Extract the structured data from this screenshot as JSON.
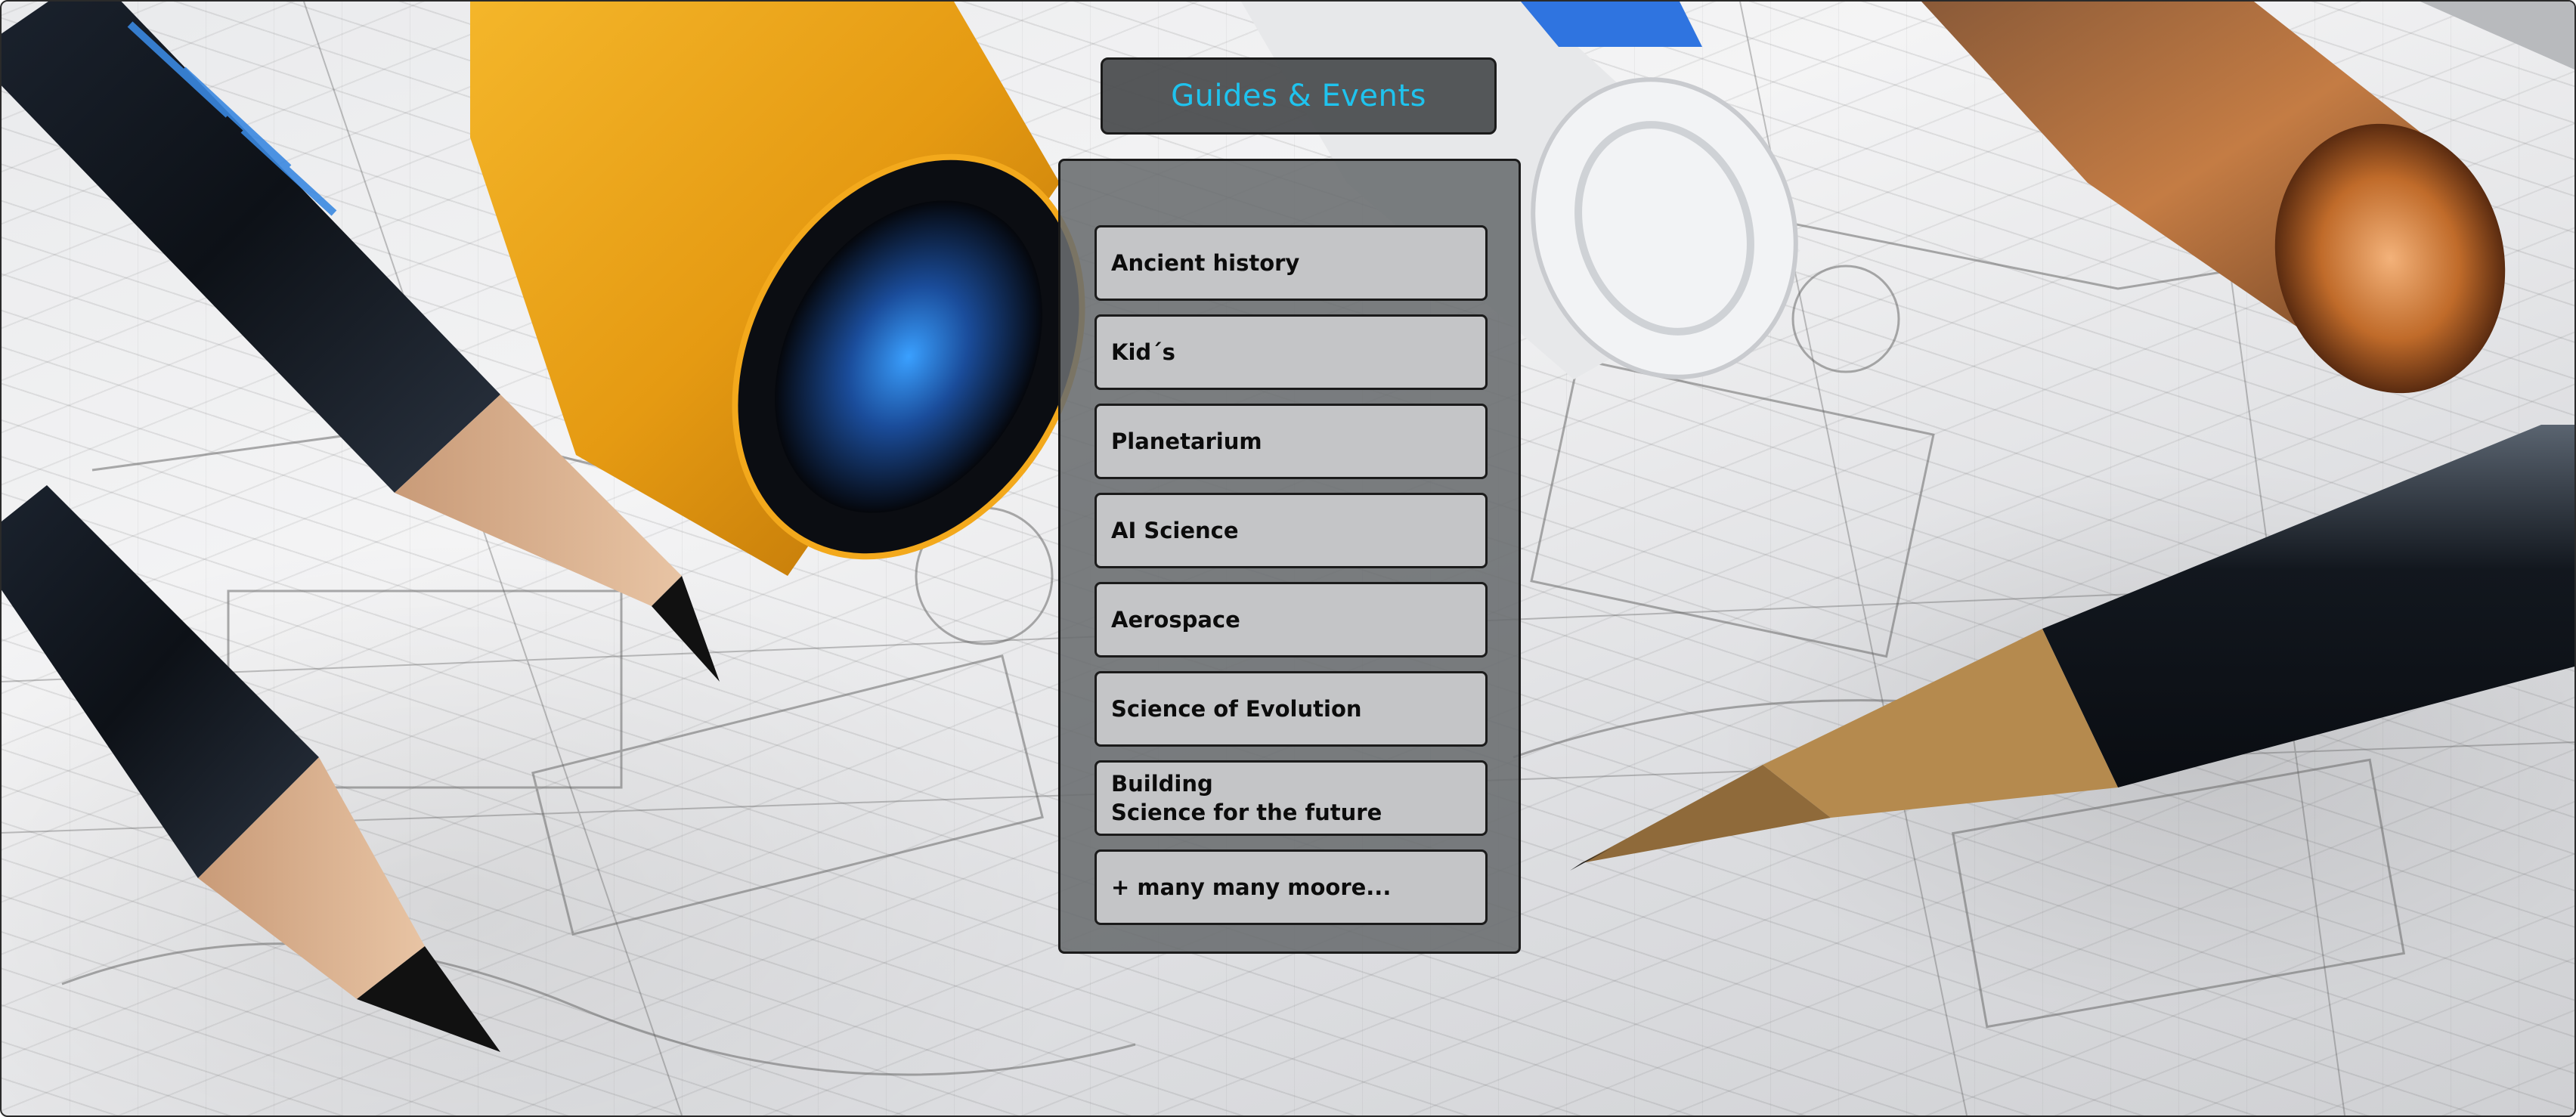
{
  "title": "Guides & Events",
  "menu": {
    "items": [
      {
        "label": "Ancient history"
      },
      {
        "label": "Kid´s"
      },
      {
        "label": "Planetarium"
      },
      {
        "label": "AI Science"
      },
      {
        "label": "Aerospace"
      },
      {
        "label": "Science of Evolution"
      },
      {
        "label": "Building\nScience for the future"
      },
      {
        "label": "+ many many moore..."
      }
    ]
  },
  "colors": {
    "title_text": "#1fc3ee",
    "title_box": "#484a4c",
    "panel": "#696c6e",
    "button": "#c4c5c7",
    "border": "#1b1b1b"
  },
  "background": {
    "icon": "blueprint-with-pencils-image"
  }
}
